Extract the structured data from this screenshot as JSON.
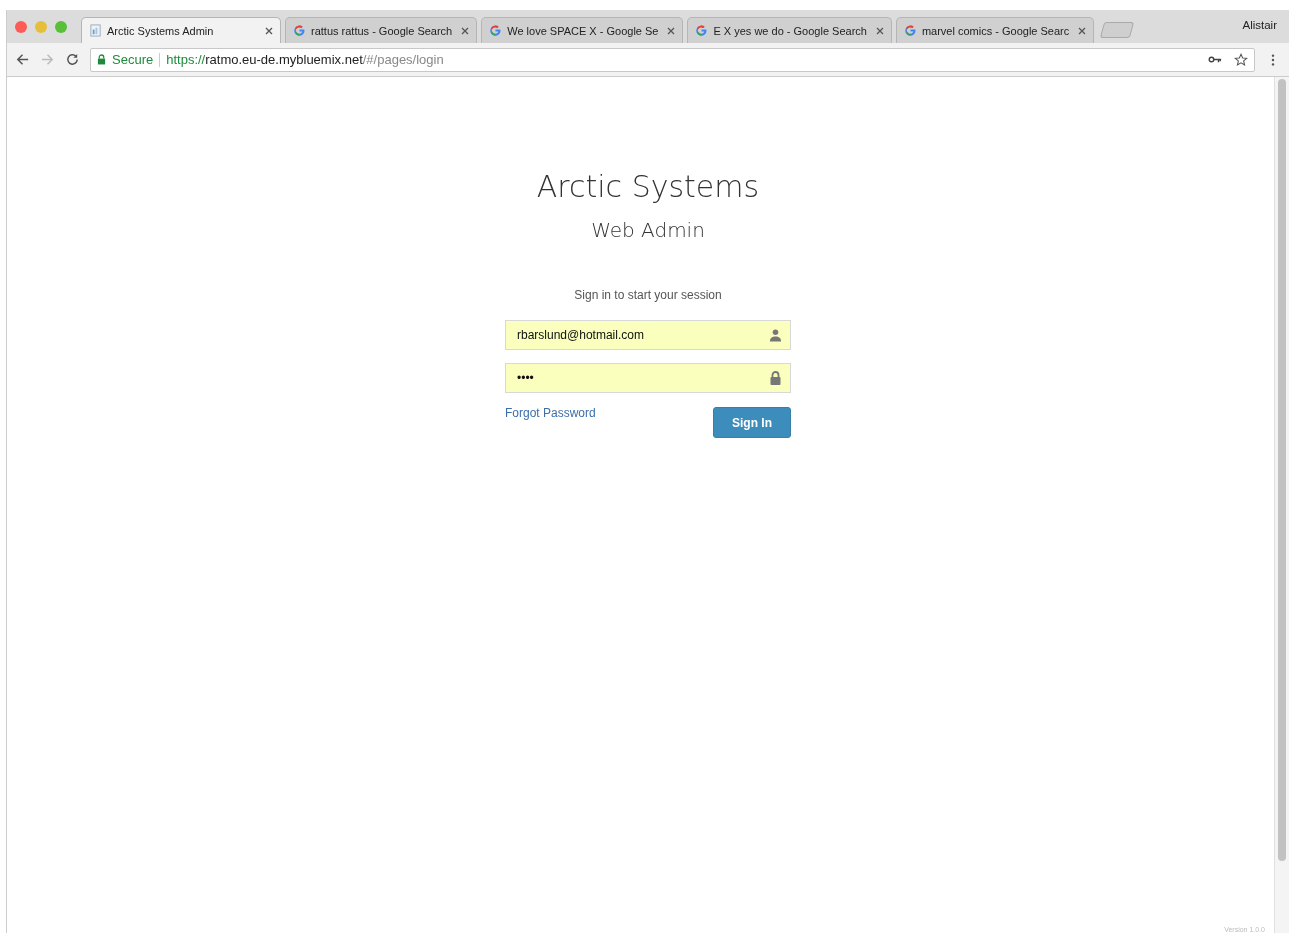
{
  "browser": {
    "tabs": [
      {
        "title": "Arctic Systems Admin",
        "selected": true,
        "kind": "document"
      },
      {
        "title": "rattus rattus - Google Search",
        "selected": false,
        "kind": "search"
      },
      {
        "title": "We love SPACE X - Google Se",
        "selected": false,
        "kind": "search"
      },
      {
        "title": "E X yes we do - Google Search",
        "selected": false,
        "kind": "search"
      },
      {
        "title": "marvel comics - Google Searc",
        "selected": false,
        "kind": "search"
      }
    ],
    "profile": "Alistair",
    "secure_label": "Secure",
    "url_scheme": "https://",
    "url_host": "ratmo.eu-de.mybluemix.net",
    "url_path": "/#/pages/login"
  },
  "page": {
    "title": "Arctic Systems",
    "subtitle": "Web Admin",
    "prompt": "Sign in to start your session",
    "email": {
      "value": "rbarslund@hotmail.com"
    },
    "password": {
      "value": "••••"
    },
    "forgot_link": "Forgot Password",
    "sign_in_button": "Sign In",
    "version": "Version 1.0.0"
  }
}
